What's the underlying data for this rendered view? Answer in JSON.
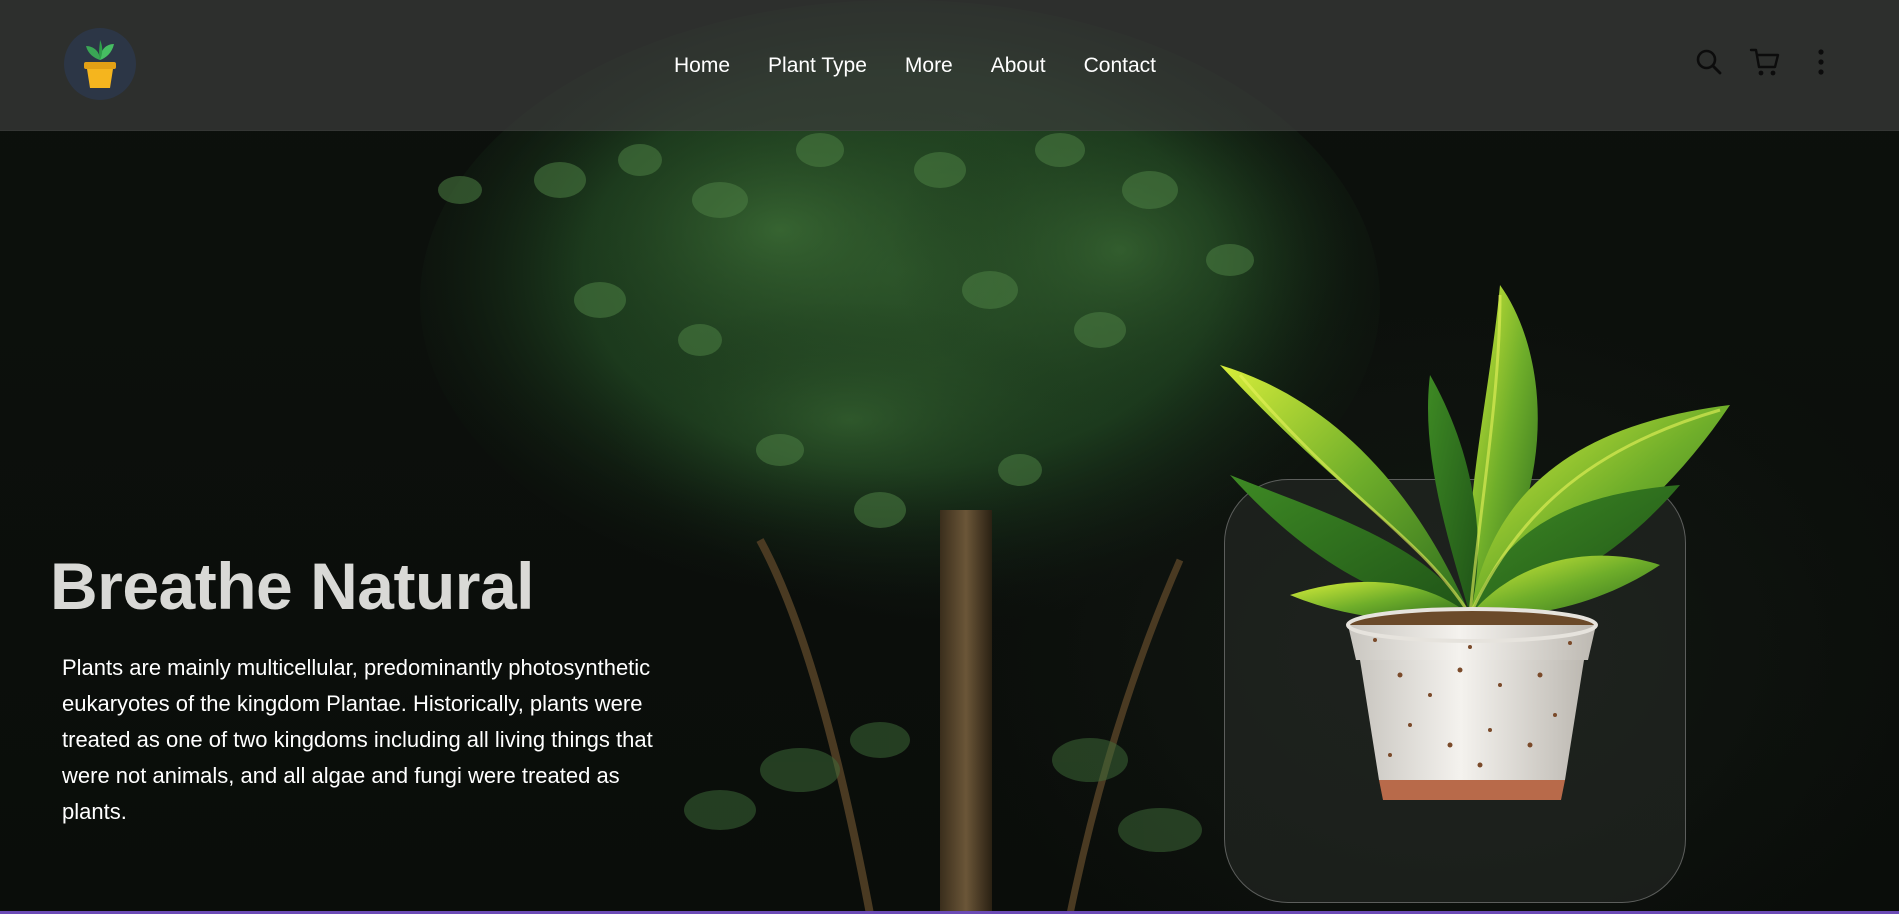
{
  "nav": {
    "links": [
      "Home",
      "Plant Type",
      "More",
      "About",
      "Contact"
    ]
  },
  "icons": {
    "logo": "plant-pot-logo",
    "search": "search-icon",
    "cart": "cart-icon",
    "more": "more-vertical-icon"
  },
  "hero": {
    "title": "Breathe Natural",
    "description": "Plants are mainly multicellular, predominantly photosynthetic eukaryotes of the kingdom Plantae. Historically, plants were treated as one of two kingdoms including all living things that were not animals, and all algae and fungi were treated as plants."
  },
  "colors": {
    "accent": "#f5b51e",
    "leaf": "#2e9e4a",
    "bottom_border": "#6c4bb6"
  }
}
